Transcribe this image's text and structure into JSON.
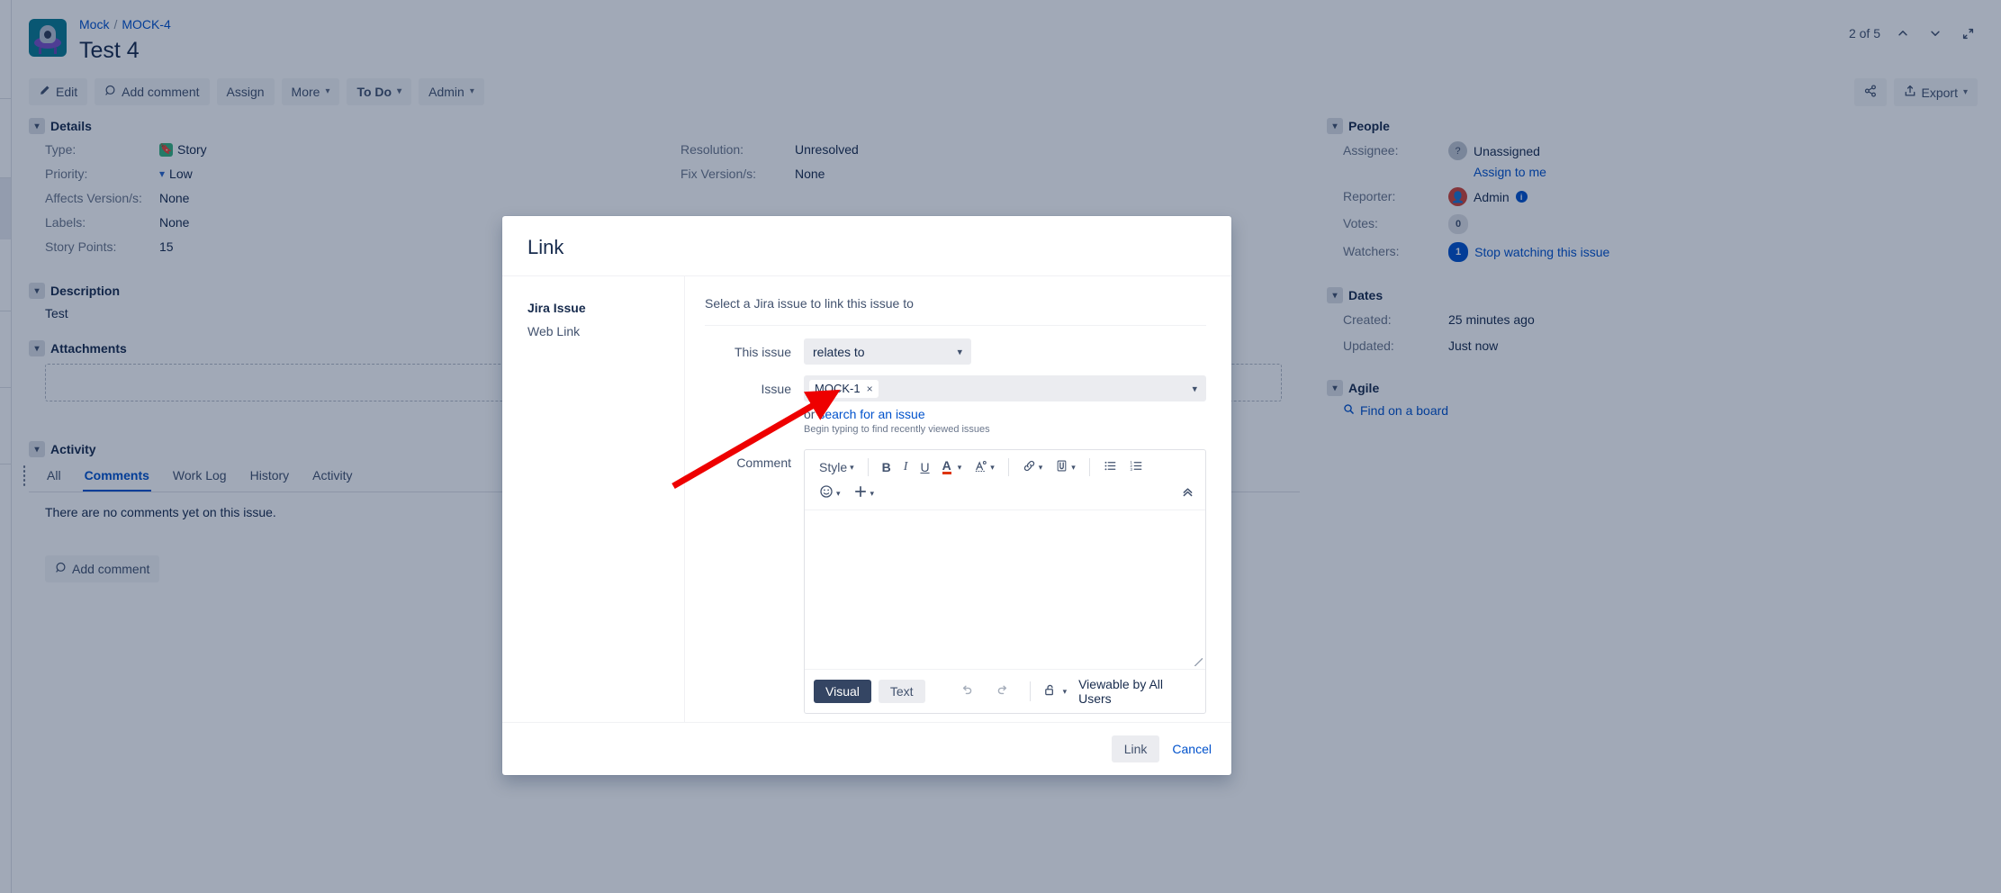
{
  "header": {
    "breadcrumb": {
      "project": "Mock",
      "separator": "/",
      "issue_key": "MOCK-4"
    },
    "title": "Test 4",
    "pager": {
      "position": "2 of 5",
      "prev_icon": "chevron-up-icon",
      "next_icon": "chevron-down-icon",
      "expand_icon": "expand-icon"
    }
  },
  "toolbar": {
    "edit": "Edit",
    "add_comment": "Add comment",
    "assign": "Assign",
    "more": "More",
    "status": "To Do",
    "admin": "Admin",
    "share_icon": "share-icon",
    "export": "Export"
  },
  "details": {
    "heading": "Details",
    "left": [
      {
        "label": "Type:",
        "value": "Story",
        "icon": "story-icon"
      },
      {
        "label": "Priority:",
        "value": "Low",
        "icon": "priority-low-icon"
      },
      {
        "label": "Affects Version/s:",
        "value": "None"
      },
      {
        "label": "Labels:",
        "value": "None"
      },
      {
        "label": "Story Points:",
        "value": "15"
      }
    ],
    "right": [
      {
        "label": "Resolution:",
        "value": "Unresolved"
      },
      {
        "label": "Fix Version/s:",
        "value": "None"
      }
    ]
  },
  "description": {
    "heading": "Description",
    "text": "Test"
  },
  "attachments": {
    "heading": "Attachments"
  },
  "activity": {
    "heading": "Activity",
    "tabs": [
      {
        "label": "All",
        "active": false
      },
      {
        "label": "Comments",
        "active": true
      },
      {
        "label": "Work Log",
        "active": false
      },
      {
        "label": "History",
        "active": false
      },
      {
        "label": "Activity",
        "active": false
      }
    ],
    "empty_text": "There are no comments yet on this issue.",
    "add_comment": "Add comment"
  },
  "sidebar": {
    "people": {
      "heading": "People",
      "assignee_label": "Assignee:",
      "assignee_value": "Unassigned",
      "assign_to_me": "Assign to me",
      "reporter_label": "Reporter:",
      "reporter_value": "Admin",
      "votes_label": "Votes:",
      "votes_value": "0",
      "watchers_label": "Watchers:",
      "watchers_count": "1",
      "watchers_link": "Stop watching this issue"
    },
    "dates": {
      "heading": "Dates",
      "created_label": "Created:",
      "created_value": "25 minutes ago",
      "updated_label": "Updated:",
      "updated_value": "Just now"
    },
    "agile": {
      "heading": "Agile",
      "find_board": "Find on a board"
    }
  },
  "modal": {
    "title": "Link",
    "nav": [
      {
        "label": "Jira Issue",
        "active": true
      },
      {
        "label": "Web Link",
        "active": false
      }
    ],
    "hint": "Select a Jira issue to link this issue to",
    "this_issue_label": "This issue",
    "link_type_value": "relates to",
    "issue_label": "Issue",
    "issue_tag": "MOCK-1",
    "issue_tag_remove": "×",
    "or_text": "or",
    "search_link": "search for an issue",
    "typing_hint": "Begin typing to find recently viewed issues",
    "comment_label": "Comment",
    "editor": {
      "style": "Style",
      "bold": "B",
      "italic": "I",
      "underline": "U",
      "text_color": "A",
      "text_effects": "text-effects-icon",
      "link_icon": "link-icon",
      "attach_icon": "paperclip-icon",
      "bullet_list_icon": "bullet-list-icon",
      "numbered_list_icon": "numbered-list-icon",
      "emoji_icon": "emoji-icon",
      "insert_icon": "plus-icon",
      "collapse_icon": "chevron-double-up-icon",
      "visual_tab": "Visual",
      "text_tab": "Text",
      "undo_icon": "undo-icon",
      "redo_icon": "redo-icon",
      "security_icon": "unlock-icon",
      "viewable": "Viewable by All Users",
      "content": ""
    },
    "submit": "Link",
    "cancel": "Cancel"
  },
  "colors": {
    "brand_blue": "#0052cc",
    "dark_navy": "#172b4d",
    "subtle_text": "#6b778c",
    "green_story": "#36b37e",
    "annotation_red": "#ee0000",
    "avatar_teal": "#0a7b92"
  }
}
